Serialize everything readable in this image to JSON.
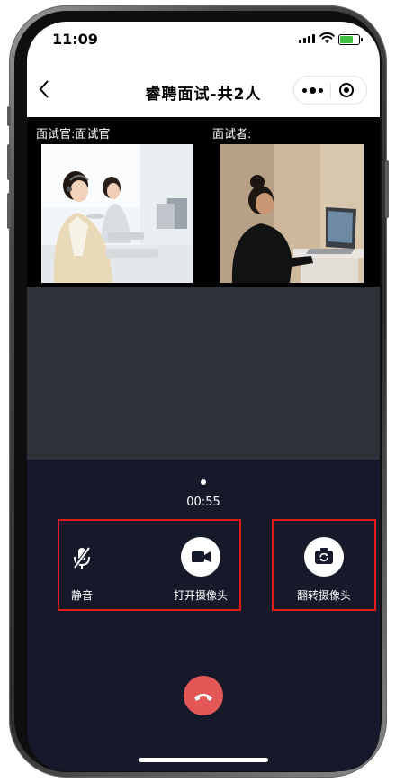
{
  "status_bar": {
    "time": "11:09"
  },
  "nav": {
    "back_icon": "chevron-left-icon",
    "title": "睿聘面试-共2人"
  },
  "videos": {
    "interviewer_label": "面试官:面试官",
    "candidate_label": "面试者:"
  },
  "call": {
    "elapsed": "00:55"
  },
  "controls": {
    "mute_label": "静音",
    "camera_label": "打开摄像头",
    "flip_label": "翻转摄像头"
  },
  "colors": {
    "hangup": "#e35757",
    "highlight": "#e11b1b",
    "panel": "#16192a"
  }
}
